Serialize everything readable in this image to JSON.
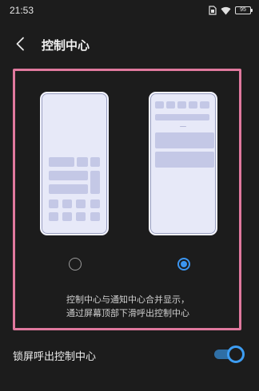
{
  "status_bar": {
    "time": "21:53",
    "battery": "95",
    "icons": [
      "sim-icon",
      "wifi-icon",
      "battery-icon"
    ]
  },
  "header": {
    "title": "控制中心",
    "back_icon": "chevron-left-icon"
  },
  "style_options": {
    "options": [
      {
        "name": "separate-style",
        "selected": false
      },
      {
        "name": "merged-with-notification-style",
        "selected": true
      }
    ]
  },
  "description": {
    "line1": "控制中心与通知中心合并显示，",
    "line2": "通过屏幕顶部下滑呼出控制中心"
  },
  "lockscreen_setting": {
    "label": "锁屏呼出控制中心",
    "enabled": true
  },
  "colors": {
    "background": "#1c1c1c",
    "highlight": "#e0799e",
    "accent": "#3b95f0",
    "phone_bg": "#e7e9f8",
    "tile": "#c4c8e6"
  }
}
